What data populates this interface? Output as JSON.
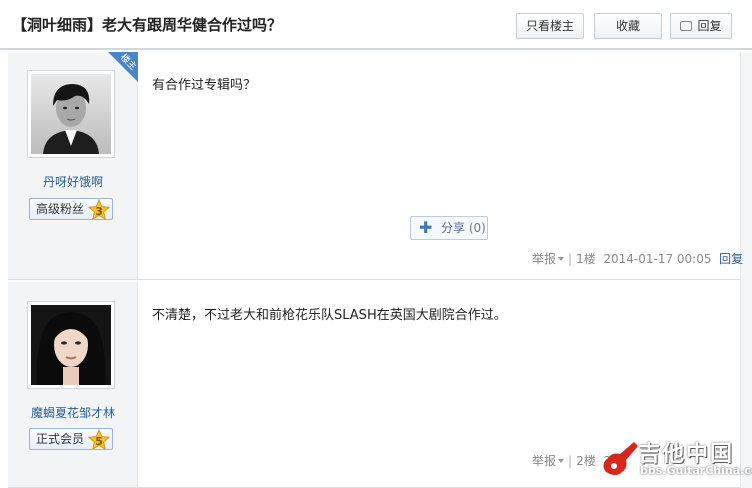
{
  "thread": {
    "title": "【洞叶细雨】老大有跟周华健合作过吗？"
  },
  "toolbar": {
    "only_op": "只看楼主",
    "favorite": "收藏",
    "reply": "回复"
  },
  "posts": [
    {
      "user": "丹呀好饿啊",
      "rank": "高级粉丝",
      "level": "3",
      "badge": "楼主",
      "content": "有合作过专辑吗？",
      "share": {
        "label": "分享",
        "count": "(0)"
      },
      "report": "举报",
      "floor": "1楼",
      "time": "2014-01-17 00:05",
      "reply": "回复"
    },
    {
      "user": "魔蝎夏花邹才林",
      "rank": "正式会员",
      "level": "5",
      "content": "不清楚，不过老大和前枪花乐队SLASH在英国大剧院合作过。",
      "report": "举报",
      "floor": "2楼",
      "time": "201"
    }
  ],
  "watermark": {
    "brand": "吉他中国",
    "url": "bbs.GuitarChina.com"
  },
  "colors": {
    "accent": "#4a86c5",
    "link": "#2a5c8f",
    "star": "#f2c230"
  }
}
